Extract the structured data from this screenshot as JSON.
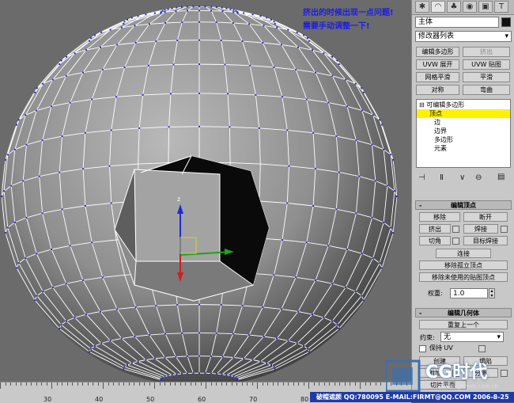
{
  "annotation": {
    "line1": "挤出的时候出现一点问题!",
    "line2": "需要手动调整一下!"
  },
  "command_panel": {
    "tab_icons": [
      "create-icon",
      "modify-icon",
      "hierarchy-icon",
      "motion-icon",
      "display-icon",
      "utilities-icon"
    ],
    "object_name": "主体",
    "object_color": "#111111",
    "modifier_list": "修改器列表",
    "modifier_buttons": [
      {
        "label": "编辑多边形",
        "enabled": true
      },
      {
        "label": "挤出",
        "enabled": false
      },
      {
        "label": "UVW 展开",
        "enabled": true
      },
      {
        "label": "UVW 贴图",
        "enabled": true
      },
      {
        "label": "网格平滑",
        "enabled": true
      },
      {
        "label": "平滑",
        "enabled": true
      },
      {
        "label": "对称",
        "enabled": true
      },
      {
        "label": "弯曲",
        "enabled": true
      }
    ],
    "stack": {
      "root": "可编辑多边形",
      "items": [
        "顶点",
        "边",
        "边界",
        "多边形",
        "元素"
      ],
      "selected": "顶点"
    },
    "stack_tool_icons": [
      "pin-stack-icon",
      "show-end-result-icon",
      "make-unique-icon",
      "remove-modifier-icon",
      "configure-icon"
    ],
    "edit_vertices": {
      "title": "编辑顶点",
      "remove": "移除",
      "break": "断开",
      "extrude": "挤出",
      "weld": "焊接",
      "chamfer": "切角",
      "target_weld": "目标焊接",
      "connect": "连接",
      "remove_isolated": "移除孤立顶点",
      "remove_unused_map": "移除未使用的贴图顶点",
      "weight_label": "权重:",
      "weight_value": "1.0"
    },
    "edit_geometry": {
      "title": "编辑几何体",
      "repeat_last": "重复上一个",
      "constraint_label": "约束:",
      "constraint_value": "无",
      "preserve_uv": "保持 UV",
      "create": "创建",
      "collapse": "塌陷",
      "attach": "附加",
      "detach": "分离",
      "slice_plane": "切片平面"
    }
  },
  "ruler": {
    "labels": [
      "30",
      "40",
      "50",
      "60",
      "70",
      "80",
      "90"
    ]
  },
  "status": {
    "text": "破帽遮颜 QQ:780095 E-MAIL:FIRMT@QQ.COM 2006-8-25"
  },
  "watermark": {
    "brand": "CG时代",
    "url": "www.cgtimes.com.cn"
  },
  "colors": {
    "viewport_bg": "#6b6b6b",
    "wire": "#ffffff",
    "vertex": "#2a2acf",
    "selection_yellow": "#fff200",
    "annotation": "#1d1de6",
    "status_bg": "#1f3aa8"
  }
}
